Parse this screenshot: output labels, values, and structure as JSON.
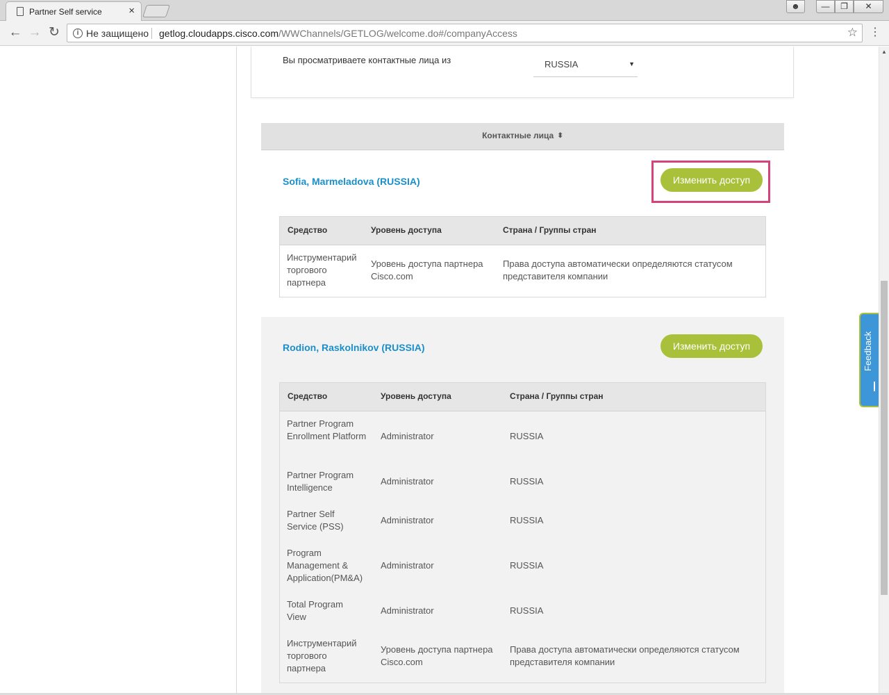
{
  "browser": {
    "tab_title": "Partner Self service",
    "tab_close": "×",
    "security_text": "Не защищено",
    "url_host": "getlog.cloudapps.cisco.com",
    "url_path": "/WWChannels/GETLOG/welcome.do#/companyAccess"
  },
  "selector": {
    "label": "Вы просматриваете контактные лица из",
    "value": "RUSSIA"
  },
  "contacts": {
    "header": "Контактные лица",
    "items": [
      {
        "name": "Sofia, Marmeladova (RUSSIA)",
        "button": "Изменить доступ",
        "columns": [
          "Средство",
          "Уровень доступа",
          "Страна / Группы стран"
        ],
        "rows": [
          {
            "tool": "Инструментарий торгового партнера",
            "level": "Уровень доступа партнера Cisco.com",
            "country": "Права доступа автоматически определяются статусом представителя компании"
          }
        ]
      },
      {
        "name": "Rodion, Raskolnikov (RUSSIA)",
        "button": "Изменить доступ",
        "columns": [
          "Средство",
          "Уровень доступа",
          "Страна / Группы стран"
        ],
        "rows": [
          {
            "tool": "Partner Program Enrollment Platform",
            "level": "Administrator",
            "country": "RUSSIA"
          },
          {
            "tool": "Partner Program Intelligence",
            "level": "Administrator",
            "country": "RUSSIA"
          },
          {
            "tool": "Partner Self Service (PSS)",
            "level": "Administrator",
            "country": "RUSSIA"
          },
          {
            "tool": "Program Management & Application(PM&A)",
            "level": "Administrator",
            "country": "RUSSIA"
          },
          {
            "tool": "Total Program View",
            "level": "Administrator",
            "country": "RUSSIA"
          },
          {
            "tool": "Инструментарий торгового партнера",
            "level": "Уровень доступа партнера Cisco.com",
            "country": "Права доступа автоматически определяются статусом представителя компании"
          }
        ]
      }
    ]
  },
  "feedback": {
    "label": "Feedback"
  },
  "colors": {
    "accent_green": "#a9c13a",
    "link_blue": "#1a8fc9",
    "highlight": "#d6437a",
    "feedback_blue": "#3c96d8"
  }
}
